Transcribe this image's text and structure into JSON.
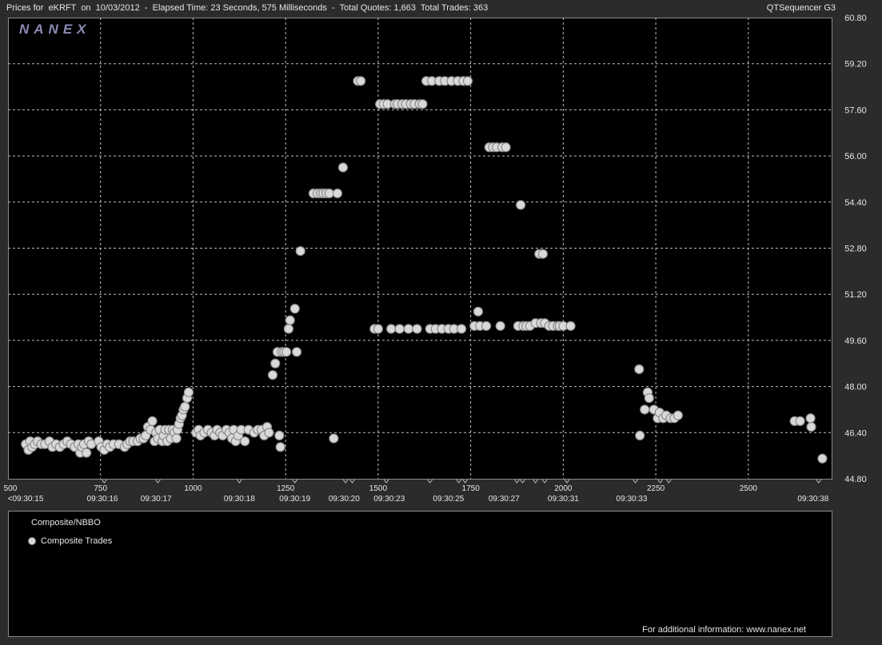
{
  "header": {
    "title": "Prices for  eKRFT  on  10/03/2012  -  Elapsed Time: 23 Seconds, 575 Milliseconds  -  Total Quotes: 1,663  Total Trades: 363",
    "app_name": "QTSequencer G3"
  },
  "logo_text": "NANEX",
  "legend": {
    "title": "Composite/NBBO",
    "entry": "Composite Trades"
  },
  "footer": "For additional information: www.nanex.net",
  "colors": {
    "background": "#2b2b2b",
    "plot_bg": "#000000",
    "grid": "#bdbdbd",
    "marker_fill": "#d9d9d9",
    "marker_stroke": "#8c8c8c",
    "logo": "#8a8ab4"
  },
  "chart_data": {
    "type": "scatter",
    "title": "",
    "xlabel": "",
    "ylabel": "",
    "xlim": [
      500,
      2725
    ],
    "ylim": [
      44.8,
      60.8
    ],
    "y_ticks": [
      "60.80",
      "59.20",
      "57.60",
      "56.00",
      "54.40",
      "52.80",
      "51.20",
      "49.60",
      "48.00",
      "46.40",
      "44.80"
    ],
    "x_ticks": [
      "500",
      "750",
      "1000",
      "1250",
      "1500",
      "1750",
      "2000",
      "2250",
      "2500"
    ],
    "time_labels": [
      {
        "x": 500,
        "label": "<09:30:15"
      },
      {
        "x": 755,
        "label": "09:30:16"
      },
      {
        "x": 900,
        "label": "09:30:17"
      },
      {
        "x": 1125,
        "label": "09:30:18"
      },
      {
        "x": 1275,
        "label": "09:30:19"
      },
      {
        "x": 1408,
        "label": "09:30:20"
      },
      {
        "x": 1530,
        "label": "09:30:23"
      },
      {
        "x": 1690,
        "label": "09:30:25"
      },
      {
        "x": 1840,
        "label": "09:30:27"
      },
      {
        "x": 2000,
        "label": "09:30:31"
      },
      {
        "x": 2185,
        "label": "09:30:33"
      },
      {
        "x": 2675,
        "label": "09:30:38"
      }
    ],
    "time_markers": [
      760,
      905,
      1125,
      1275,
      1412,
      1430,
      1522,
      1640,
      1718,
      1735,
      1875,
      1890,
      1925,
      1950,
      2010,
      2195,
      2262,
      2285,
      2690
    ],
    "grid": true,
    "legend_position": "bottom-panel",
    "series": [
      {
        "name": "Composite Trades",
        "points": [
          [
            548,
            46.0
          ],
          [
            555,
            45.8
          ],
          [
            560,
            46.1
          ],
          [
            565,
            45.9
          ],
          [
            572,
            46.0
          ],
          [
            580,
            46.1
          ],
          [
            590,
            46.0
          ],
          [
            600,
            46.0
          ],
          [
            612,
            46.1
          ],
          [
            620,
            45.9
          ],
          [
            630,
            46.0
          ],
          [
            640,
            45.9
          ],
          [
            650,
            46.0
          ],
          [
            660,
            46.1
          ],
          [
            670,
            46.0
          ],
          [
            680,
            45.9
          ],
          [
            690,
            46.0
          ],
          [
            695,
            45.7
          ],
          [
            700,
            45.9
          ],
          [
            705,
            46.0
          ],
          [
            712,
            45.7
          ],
          [
            718,
            46.1
          ],
          [
            725,
            46.0
          ],
          [
            745,
            46.1
          ],
          [
            752,
            45.9
          ],
          [
            760,
            45.8
          ],
          [
            768,
            46.0
          ],
          [
            775,
            45.9
          ],
          [
            785,
            46.0
          ],
          [
            800,
            46.0
          ],
          [
            815,
            45.9
          ],
          [
            822,
            46.0
          ],
          [
            830,
            46.1
          ],
          [
            838,
            46.1
          ],
          [
            850,
            46.1
          ],
          [
            858,
            46.2
          ],
          [
            866,
            46.2
          ],
          [
            872,
            46.3
          ],
          [
            878,
            46.6
          ],
          [
            885,
            46.5
          ],
          [
            890,
            46.8
          ],
          [
            896,
            46.1
          ],
          [
            900,
            46.4
          ],
          [
            905,
            46.2
          ],
          [
            910,
            46.5
          ],
          [
            917,
            46.1
          ],
          [
            920,
            46.3
          ],
          [
            925,
            46.5
          ],
          [
            930,
            46.1
          ],
          [
            935,
            46.5
          ],
          [
            940,
            46.2
          ],
          [
            945,
            46.5
          ],
          [
            950,
            46.4
          ],
          [
            955,
            46.2
          ],
          [
            958,
            46.5
          ],
          [
            962,
            46.7
          ],
          [
            966,
            46.9
          ],
          [
            970,
            47.0
          ],
          [
            974,
            47.2
          ],
          [
            978,
            47.3
          ],
          [
            984,
            47.6
          ],
          [
            988,
            47.8
          ],
          [
            1008,
            46.4
          ],
          [
            1015,
            46.5
          ],
          [
            1020,
            46.3
          ],
          [
            1030,
            46.4
          ],
          [
            1040,
            46.5
          ],
          [
            1050,
            46.4
          ],
          [
            1058,
            46.3
          ],
          [
            1065,
            46.5
          ],
          [
            1073,
            46.4
          ],
          [
            1080,
            46.3
          ],
          [
            1090,
            46.5
          ],
          [
            1098,
            46.4
          ],
          [
            1105,
            46.2
          ],
          [
            1110,
            46.5
          ],
          [
            1115,
            46.1
          ],
          [
            1122,
            46.3
          ],
          [
            1130,
            46.5
          ],
          [
            1140,
            46.1
          ],
          [
            1150,
            46.5
          ],
          [
            1165,
            46.4
          ],
          [
            1175,
            46.5
          ],
          [
            1185,
            46.5
          ],
          [
            1192,
            46.3
          ],
          [
            1200,
            46.6
          ],
          [
            1205,
            46.4
          ],
          [
            1215,
            48.4
          ],
          [
            1222,
            48.8
          ],
          [
            1228,
            49.2
          ],
          [
            1233,
            46.3
          ],
          [
            1236,
            45.9
          ],
          [
            1240,
            49.2
          ],
          [
            1246,
            49.2
          ],
          [
            1252,
            49.2
          ],
          [
            1258,
            50.0
          ],
          [
            1262,
            50.3
          ],
          [
            1275,
            50.7
          ],
          [
            1280,
            49.2
          ],
          [
            1290,
            52.7
          ],
          [
            1325,
            54.7
          ],
          [
            1336,
            54.7
          ],
          [
            1345,
            54.7
          ],
          [
            1352,
            54.7
          ],
          [
            1360,
            54.7
          ],
          [
            1368,
            54.7
          ],
          [
            1380,
            46.2
          ],
          [
            1390,
            54.7
          ],
          [
            1405,
            55.6
          ],
          [
            1445,
            58.6
          ],
          [
            1453,
            58.6
          ],
          [
            1490,
            50.0
          ],
          [
            1500,
            50.0
          ],
          [
            1505,
            57.8
          ],
          [
            1515,
            57.8
          ],
          [
            1525,
            57.8
          ],
          [
            1535,
            50.0
          ],
          [
            1545,
            57.8
          ],
          [
            1552,
            57.8
          ],
          [
            1558,
            50.0
          ],
          [
            1565,
            57.8
          ],
          [
            1575,
            57.8
          ],
          [
            1582,
            50.0
          ],
          [
            1588,
            57.8
          ],
          [
            1598,
            57.8
          ],
          [
            1605,
            50.0
          ],
          [
            1612,
            57.8
          ],
          [
            1620,
            57.8
          ],
          [
            1630,
            58.6
          ],
          [
            1640,
            50.0
          ],
          [
            1645,
            58.6
          ],
          [
            1655,
            50.0
          ],
          [
            1665,
            58.6
          ],
          [
            1672,
            50.0
          ],
          [
            1680,
            58.6
          ],
          [
            1690,
            50.0
          ],
          [
            1698,
            58.6
          ],
          [
            1705,
            50.0
          ],
          [
            1715,
            58.6
          ],
          [
            1725,
            50.0
          ],
          [
            1730,
            58.6
          ],
          [
            1742,
            58.6
          ],
          [
            1760,
            50.1
          ],
          [
            1770,
            50.6
          ],
          [
            1775,
            50.1
          ],
          [
            1792,
            50.1
          ],
          [
            1800,
            56.3
          ],
          [
            1810,
            56.3
          ],
          [
            1820,
            56.3
          ],
          [
            1830,
            50.1
          ],
          [
            1835,
            56.3
          ],
          [
            1845,
            56.3
          ],
          [
            1878,
            50.1
          ],
          [
            1885,
            54.3
          ],
          [
            1892,
            50.1
          ],
          [
            1900,
            50.1
          ],
          [
            1910,
            50.1
          ],
          [
            1925,
            50.2
          ],
          [
            1935,
            52.6
          ],
          [
            1940,
            50.2
          ],
          [
            1945,
            52.6
          ],
          [
            1950,
            50.2
          ],
          [
            1962,
            50.1
          ],
          [
            1972,
            50.1
          ],
          [
            1985,
            50.1
          ],
          [
            1990,
            50.1
          ],
          [
            2000,
            50.1
          ],
          [
            2020,
            50.1
          ],
          [
            2205,
            48.6
          ],
          [
            2207,
            46.3
          ],
          [
            2220,
            47.2
          ],
          [
            2228,
            47.8
          ],
          [
            2232,
            47.6
          ],
          [
            2245,
            47.2
          ],
          [
            2255,
            46.9
          ],
          [
            2260,
            47.1
          ],
          [
            2270,
            46.9
          ],
          [
            2278,
            47.0
          ],
          [
            2290,
            46.9
          ],
          [
            2300,
            46.9
          ],
          [
            2310,
            47.0
          ],
          [
            2625,
            46.8
          ],
          [
            2640,
            46.8
          ],
          [
            2668,
            46.9
          ],
          [
            2670,
            46.6
          ],
          [
            2700,
            45.5
          ]
        ]
      }
    ]
  }
}
